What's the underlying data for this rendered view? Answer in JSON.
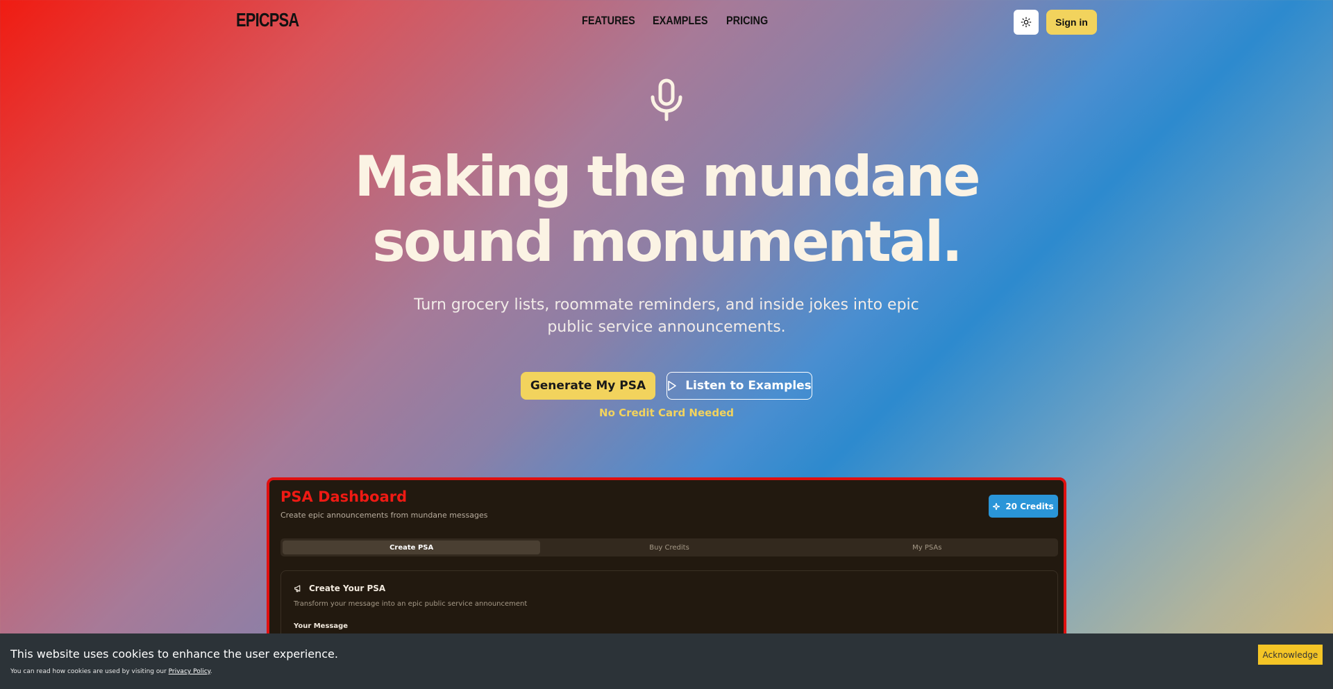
{
  "header": {
    "logo": "EPICPSA",
    "nav": [
      "FEATURES",
      "EXAMPLES",
      "PRICING"
    ],
    "theme_icon": "sun-icon",
    "signin_label": "Sign in"
  },
  "hero": {
    "icon": "microphone-icon",
    "headline_line1": "Making the mundane",
    "headline_line2": "sound monumental.",
    "subtitle": "Turn grocery lists, roommate reminders, and inside jokes into epic public service announcements.",
    "primary_cta": "Generate My PSA",
    "secondary_cta": "Listen to Examples",
    "secondary_icon": "play-icon",
    "note": "No Credit Card Needed"
  },
  "dashboard": {
    "title": "PSA Dashboard",
    "subtitle": "Create epic announcements from mundane messages",
    "credits_label": "20 Credits",
    "credits_icon": "sparkle-icon",
    "tabs": [
      "Create PSA",
      "Buy Credits",
      "My PSAs"
    ],
    "active_tab": "Create PSA",
    "card": {
      "icon": "megaphone-icon",
      "title": "Create Your PSA",
      "subtitle": "Transform your message into an epic public service announcement",
      "field_label": "Your Message"
    }
  },
  "cookie_banner": {
    "message": "This website uses cookies to enhance the user experience.",
    "detail_prefix": "You can read how cookies are used by visiting our ",
    "detail_link": "Privacy Policy",
    "detail_suffix": ".",
    "button_label": "Acknowledge"
  },
  "colors": {
    "accent_yellow": "#f2d35d",
    "dash_red": "#ef1a14",
    "credits_blue": "#2a95d8"
  }
}
